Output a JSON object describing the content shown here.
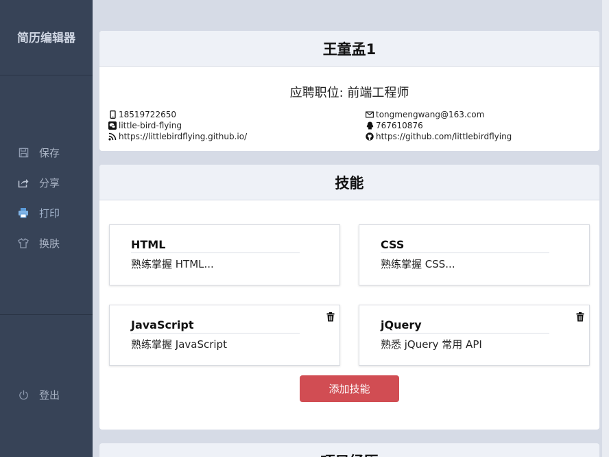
{
  "sidebar": {
    "brand": "简历编辑器",
    "items": [
      {
        "label": "保存"
      },
      {
        "label": "分享"
      },
      {
        "label": "打印"
      },
      {
        "label": "换肤"
      }
    ],
    "logout": "登出"
  },
  "profile": {
    "name": "王童孟1",
    "job": "应聘职位: 前端工程师",
    "phone": "18519722650",
    "email": "tongmengwang@163.com",
    "wechat": "little-bird-flying",
    "qq": "767610876",
    "blog": "https://littlebirdflying.github.io/",
    "github": "https://github.com/littlebirdflying"
  },
  "skills": {
    "title": "技能",
    "items": [
      {
        "name": "HTML",
        "desc": "熟练掌握 HTML..."
      },
      {
        "name": "CSS",
        "desc": "熟练掌握 CSS..."
      },
      {
        "name": "JavaScript",
        "desc": "熟练掌握 JavaScript"
      },
      {
        "name": "jQuery",
        "desc": "熟悉 jQuery 常用 API"
      }
    ],
    "add_label": "添加技能"
  },
  "projects": {
    "title": "项目经历"
  },
  "colors": {
    "sidebar_bg": "#374357",
    "page_bg": "#d6dbe6",
    "add_button": "#d14d53"
  }
}
